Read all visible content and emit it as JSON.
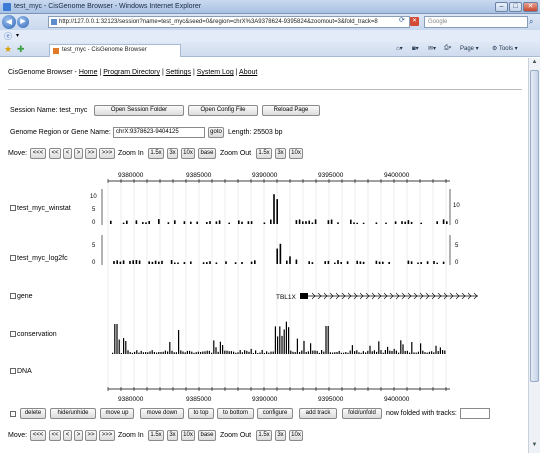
{
  "browser": {
    "window_title": "test_myc - CisGenome Browser - Windows Internet Explorer",
    "url": "http://127.0.0.1:32123/session?name=test_myc&seed=0&region=chrX%3A9378624-9395824&zoomout=3&fold_track=8",
    "search_placeholder": "Google",
    "tab_title": "test_myc - CisGenome Browser",
    "page_menu": "Page",
    "tools_menu": "Tools"
  },
  "nav": {
    "app_name": "CisGenome Browser -",
    "links": [
      "Home",
      "Program Directory",
      "Settings",
      "System Log",
      "About"
    ]
  },
  "session": {
    "label": "Session Name: test_myc",
    "open_session_folder": "Open Session Folder",
    "open_config_file": "Open Config File",
    "reload_page": "Reload Page"
  },
  "region": {
    "label": "Genome Region or Gene Name:",
    "value": "chrX:9378623-9404125",
    "go": "goto",
    "length": "Length: 25503 bp"
  },
  "move_bar": {
    "move": "Move:",
    "buttons": [
      "<<<",
      "<<",
      "<",
      ">",
      ">>",
      ">>>"
    ],
    "zoom_in": "Zoom In",
    "zoom_in_buttons": [
      "1.5x",
      "3x",
      "10x",
      "base"
    ],
    "zoom_out": "Zoom Out",
    "zoom_out_buttons": [
      "1.5x",
      "3x",
      "10x"
    ]
  },
  "tracks": [
    {
      "label": "test_myc_winstat"
    },
    {
      "label": "test_myc_log2fc"
    },
    {
      "label": "gene"
    },
    {
      "label": "conservation"
    },
    {
      "label": "DNA"
    }
  ],
  "axis": {
    "ticks": [
      "9380000",
      "9385000",
      "9390000",
      "9395000",
      "9400000"
    ],
    "winstat_ticks": [
      "10",
      "5",
      "0"
    ],
    "winstat_right": [
      "10",
      "0"
    ],
    "log2fc_ticks": [
      "5",
      "0"
    ],
    "log2fc_right": [
      "5",
      "0"
    ]
  },
  "gene_label": "TBL1X",
  "actions": {
    "buttons": [
      "delete",
      "hide/unhide",
      "move up",
      "move down",
      "to top",
      "to bottom",
      "configure",
      "add track",
      "fold/unfold"
    ],
    "folded_label": "now folded with tracks:",
    "folded_value": ""
  }
}
